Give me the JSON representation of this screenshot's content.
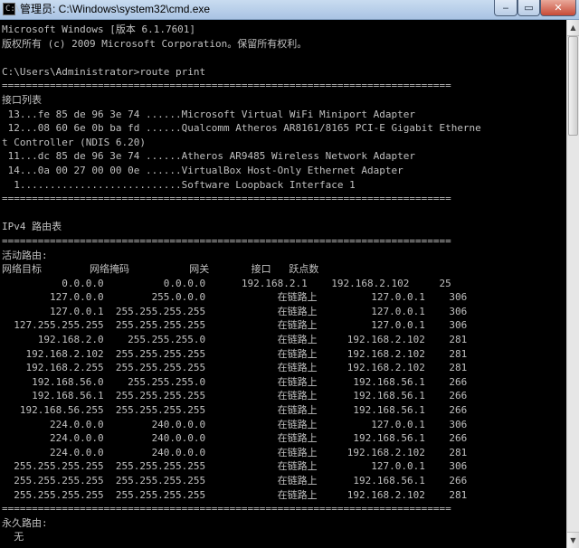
{
  "window": {
    "title": "管理员: C:\\Windows\\system32\\cmd.exe",
    "icon_label": "C:\\",
    "controls": {
      "minimize": "‒",
      "maximize": "▭",
      "close": "✕"
    }
  },
  "scrollbar": {
    "up_arrow": "▲",
    "down_arrow": "▼"
  },
  "console": {
    "lines": [
      "Microsoft Windows [版本 6.1.7601]",
      "版权所有 (c) 2009 Microsoft Corporation。保留所有权利。",
      "",
      "C:\\Users\\Administrator>route print",
      "===========================================================================",
      "接口列表",
      " 13...fe 85 de 96 3e 74 ......Microsoft Virtual WiFi Miniport Adapter",
      " 12...08 60 6e 0b ba fd ......Qualcomm Atheros AR8161/8165 PCI-E Gigabit Etherne",
      "t Controller (NDIS 6.20)",
      " 11...dc 85 de 96 3e 74 ......Atheros AR9485 Wireless Network Adapter",
      " 14...0a 00 27 00 00 0e ......VirtualBox Host-Only Ethernet Adapter",
      "  1...........................Software Loopback Interface 1",
      "===========================================================================",
      "",
      "IPv4 路由表",
      "===========================================================================",
      "活动路由:",
      "网络目标        网络掩码          网关       接口   跃点数",
      "          0.0.0.0          0.0.0.0      192.168.2.1    192.168.2.102     25",
      "        127.0.0.0        255.0.0.0            在链路上         127.0.0.1    306",
      "        127.0.0.1  255.255.255.255            在链路上         127.0.0.1    306",
      "  127.255.255.255  255.255.255.255            在链路上         127.0.0.1    306",
      "      192.168.2.0    255.255.255.0            在链路上     192.168.2.102    281",
      "    192.168.2.102  255.255.255.255            在链路上     192.168.2.102    281",
      "    192.168.2.255  255.255.255.255            在链路上     192.168.2.102    281",
      "     192.168.56.0    255.255.255.0            在链路上      192.168.56.1    266",
      "     192.168.56.1  255.255.255.255            在链路上      192.168.56.1    266",
      "   192.168.56.255  255.255.255.255            在链路上      192.168.56.1    266",
      "        224.0.0.0        240.0.0.0            在链路上         127.0.0.1    306",
      "        224.0.0.0        240.0.0.0            在链路上      192.168.56.1    266",
      "        224.0.0.0        240.0.0.0            在链路上     192.168.2.102    281",
      "  255.255.255.255  255.255.255.255            在链路上         127.0.0.1    306",
      "  255.255.255.255  255.255.255.255            在链路上      192.168.56.1    266",
      "  255.255.255.255  255.255.255.255            在链路上     192.168.2.102    281",
      "===========================================================================",
      "永久路由:",
      "  无"
    ]
  }
}
